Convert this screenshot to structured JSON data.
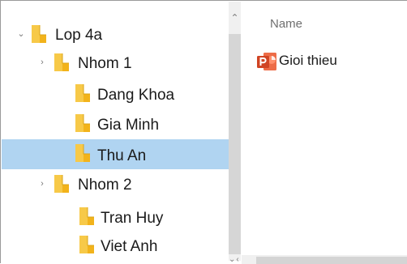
{
  "tree": {
    "nodes": [
      {
        "label": "Lop 4a",
        "chevron": "chevron-down-icon",
        "selected": false
      },
      {
        "label": "Nhom 1",
        "chevron": "chevron-right-icon",
        "selected": false
      },
      {
        "label": "Dang Khoa",
        "chevron": "",
        "selected": false
      },
      {
        "label": "Gia Minh",
        "chevron": "",
        "selected": false
      },
      {
        "label": "Thu An",
        "chevron": "",
        "selected": true
      },
      {
        "label": "Nhom 2",
        "chevron": "chevron-right-icon",
        "selected": false
      },
      {
        "label": "Tran Huy",
        "chevron": "",
        "selected": false
      },
      {
        "label": "Viet Anh",
        "chevron": "",
        "selected": false
      }
    ]
  },
  "content": {
    "column_header": "Name",
    "files": [
      {
        "name": "Gioi thieu",
        "icon": "powerpoint-icon"
      }
    ]
  },
  "colors": {
    "selection": "#b0d4f1",
    "folder": "#f7c948",
    "powerpoint": "#d04423"
  }
}
